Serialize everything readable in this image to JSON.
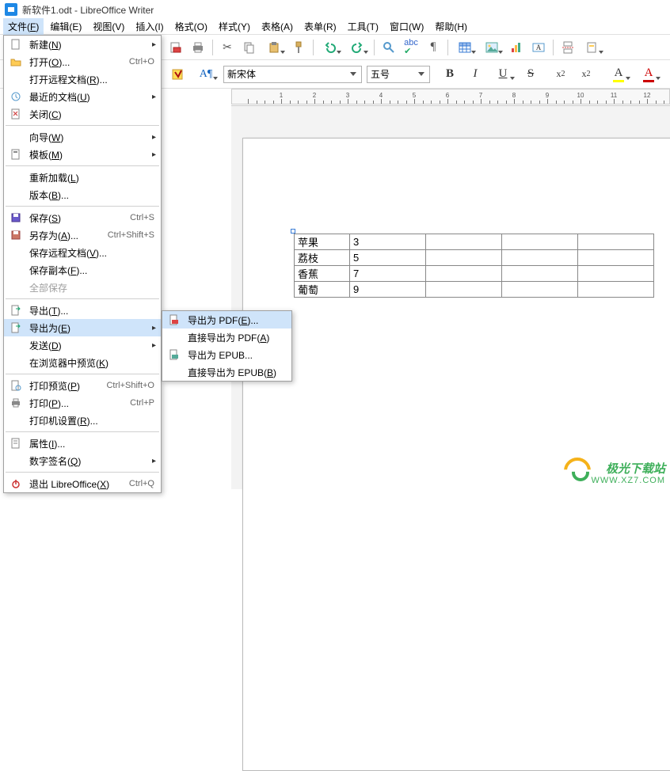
{
  "title": "新软件1.odt - LibreOffice Writer",
  "menubar": [
    "文件(F)",
    "编辑(E)",
    "视图(V)",
    "插入(I)",
    "格式(O)",
    "样式(Y)",
    "表格(A)",
    "表单(R)",
    "工具(T)",
    "窗口(W)",
    "帮助(H)"
  ],
  "font_row": {
    "font_name": "新宋体",
    "font_size": "五号"
  },
  "format_buttons": {
    "bold": "B",
    "italic": "I",
    "underline": "U",
    "strike": "S",
    "sup": "x²",
    "sub": "x₂",
    "hilite_glyph": "A",
    "color_glyph": "A"
  },
  "file_menu": {
    "new": "新建(N)",
    "open": "打开(O)...",
    "open_sc": "Ctrl+O",
    "open_remote": "打开远程文档(R)...",
    "recent": "最近的文档(U)",
    "close": "关闭(C)",
    "wizard": "向导(W)",
    "template": "模板(M)",
    "reload": "重新加载(L)",
    "version": "版本(B)...",
    "save": "保存(S)",
    "save_sc": "Ctrl+S",
    "saveas": "另存为(A)...",
    "saveas_sc": "Ctrl+Shift+S",
    "save_remote": "保存远程文档(V)...",
    "save_copy": "保存副本(F)...",
    "save_all": "全部保存",
    "export": "导出(T)...",
    "export_as": "导出为(E)",
    "send": "发送(D)",
    "preview_browser": "在浏览器中预览(K)",
    "print_preview": "打印预览(P)",
    "print_preview_sc": "Ctrl+Shift+O",
    "print": "打印(P)...",
    "print_sc": "Ctrl+P",
    "printer_settings": "打印机设置(R)...",
    "properties": "属性(I)...",
    "digital_sig": "数字签名(Q)",
    "exit": "退出 LibreOffice(X)",
    "exit_sc": "Ctrl+Q"
  },
  "export_submenu": {
    "pdf": "导出为 PDF(E)...",
    "direct_pdf": "直接导出为 PDF(A)",
    "epub": "导出为 EPUB...",
    "direct_epub": "直接导出为 EPUB(B)"
  },
  "chart_data": {
    "type": "table",
    "rows": [
      [
        "苹果",
        "3",
        "",
        "",
        ""
      ],
      [
        "荔枝",
        "5",
        "",
        "",
        ""
      ],
      [
        "香蕉",
        "7",
        "",
        "",
        ""
      ],
      [
        "葡萄",
        "9",
        "",
        "",
        ""
      ]
    ]
  },
  "ruler_numbers": [
    1,
    2,
    3,
    4,
    5,
    6,
    7,
    8,
    9,
    10,
    11,
    12
  ],
  "watermark": {
    "brand": "极光下载站",
    "url": "WWW.XZ7.COM"
  }
}
